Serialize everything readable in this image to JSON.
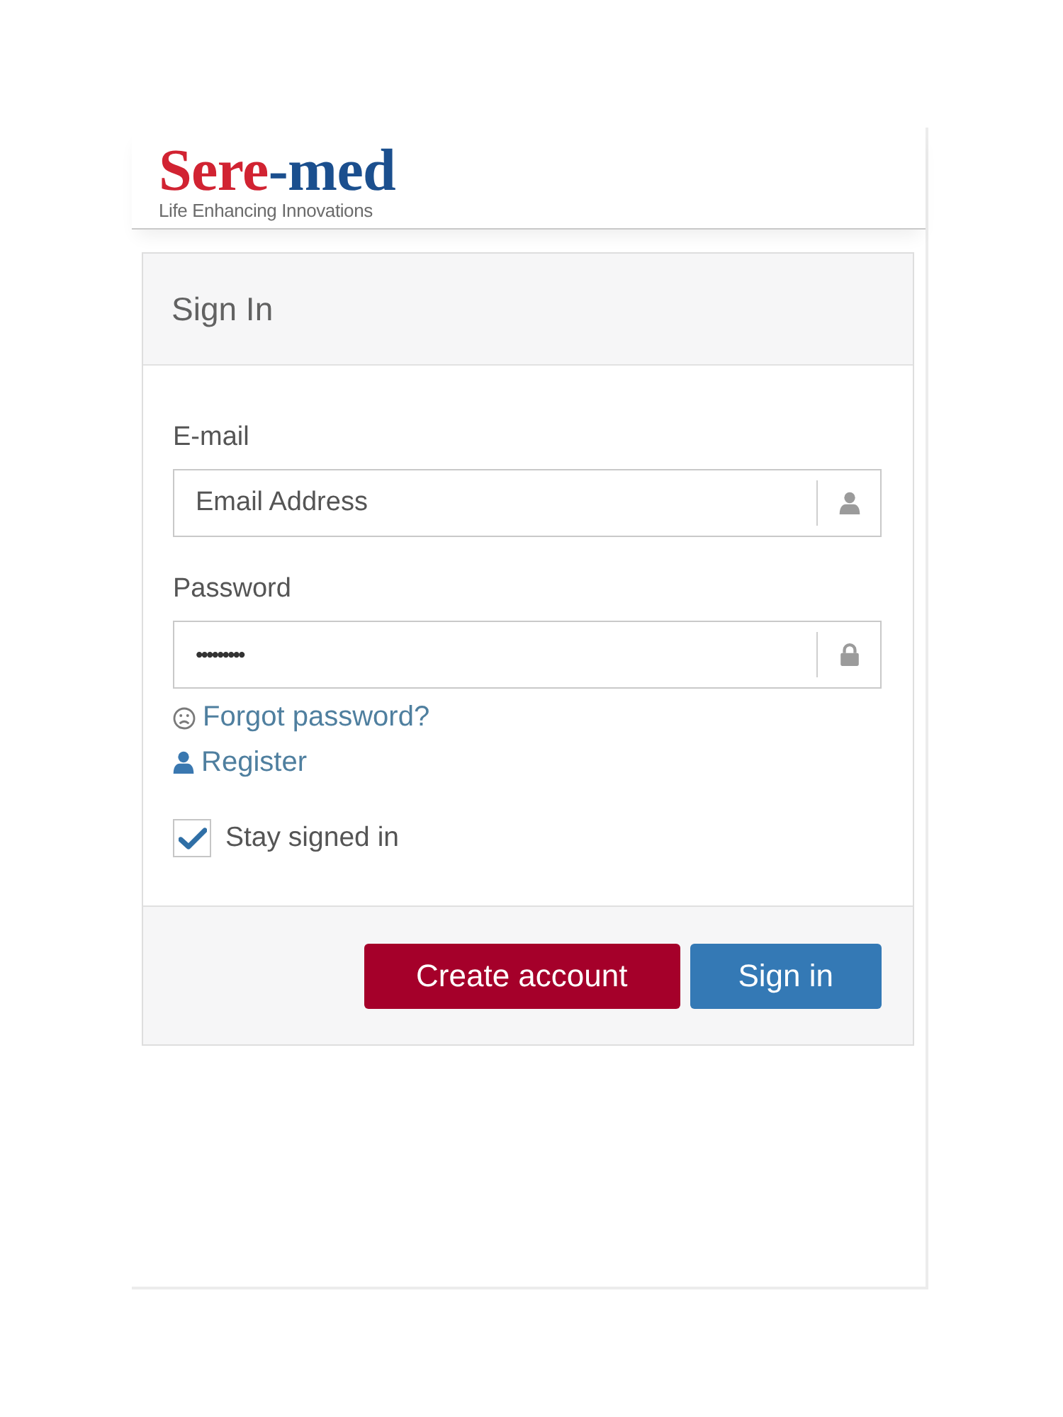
{
  "logo": {
    "name_parts": [
      "Sere",
      "-med"
    ],
    "tagline": "Life Enhancing Innovations"
  },
  "card": {
    "title": "Sign In"
  },
  "fields": [
    {
      "kind": "email",
      "label": "E-mail",
      "placeholder": "Email Address"
    },
    {
      "kind": "password",
      "label": "Password",
      "value": "•••••••••"
    }
  ],
  "links": [
    {
      "kind": "forgot",
      "label": "Forgot password?"
    },
    {
      "kind": "register",
      "label": "Register"
    }
  ],
  "stay_signed_in": {
    "label": "Stay signed in",
    "checked": true
  },
  "buttons": [
    {
      "kind": "create",
      "label": "Create account"
    },
    {
      "kind": "signin",
      "label": "Sign in"
    }
  ]
}
